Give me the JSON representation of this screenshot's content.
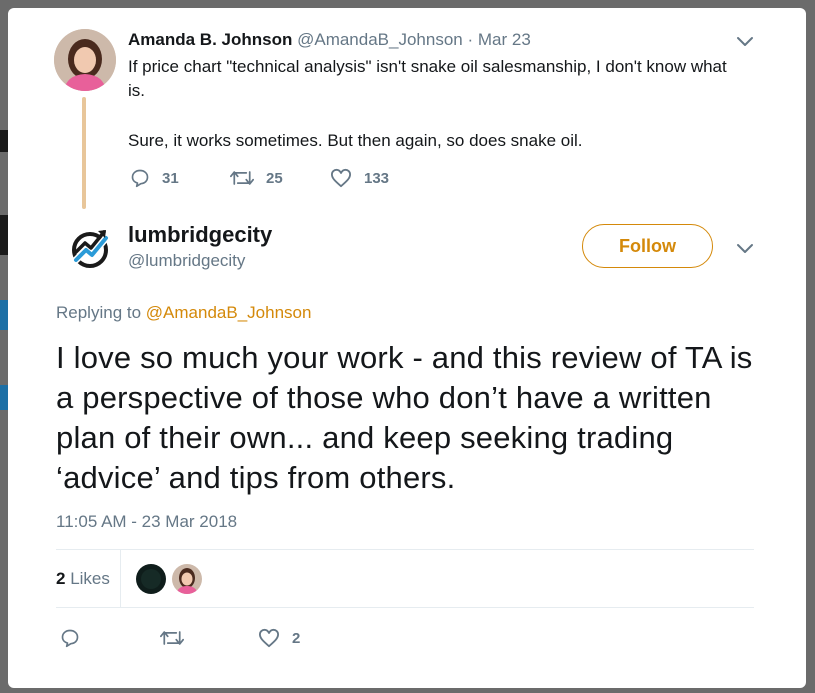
{
  "original_tweet": {
    "author_name": "Amanda B. Johnson",
    "author_handle": "@AmandaB_Johnson",
    "separator": "·",
    "date": "Mar 23",
    "text_paragraph_1": "If price chart \"technical analysis\" isn't snake oil salesmanship, I don't know what is.",
    "text_paragraph_2": "Sure, it works sometimes. But then again, so does snake oil.",
    "reply_count": "31",
    "retweet_count": "25",
    "like_count": "133"
  },
  "reply_tweet": {
    "author_name": "lumbridgecity",
    "author_handle": "@lumbridgecity",
    "follow_label": "Follow",
    "replying_prefix": "Replying to",
    "replying_to": "@AmandaB_Johnson",
    "text": "I love so much your work - and this review of TA is a perspective of those who don’t have a written plan of their own... and keep seeking trading ‘advice’ and tips from others.",
    "timestamp": "11:05 AM - 23 Mar 2018",
    "likes_number": "2",
    "likes_label": "Likes",
    "like_count": "2"
  },
  "colors": {
    "accent": "#d4890a",
    "secondary_text": "#657786",
    "primary_text": "#14171a",
    "thread_line": "#e8c69a"
  },
  "icons": [
    "chevron-down-icon",
    "reply-icon",
    "retweet-icon",
    "heart-icon",
    "logo-icon"
  ]
}
